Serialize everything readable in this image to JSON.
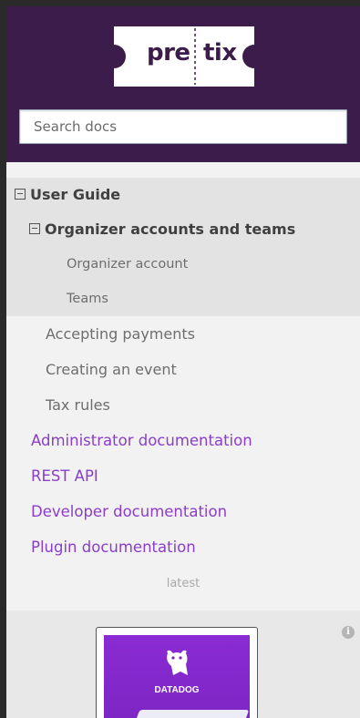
{
  "header": {
    "logo": {
      "left": "pre",
      "right": "tix"
    },
    "search": {
      "placeholder": "Search docs"
    }
  },
  "menu": {
    "user_guide": "User Guide",
    "organizer_accounts": "Organizer accounts and teams",
    "organizer_account": "Organizer account",
    "teams": "Teams",
    "accepting_payments": "Accepting payments",
    "creating_event": "Creating an event",
    "tax_rules": "Tax rules",
    "admin_docs": "Administrator documentation",
    "rest_api": "REST API",
    "developer_docs": "Developer documentation",
    "plugin_docs": "Plugin documentation"
  },
  "version": "latest",
  "ad": {
    "brand": "DATADOG",
    "info": "i"
  },
  "colors": {
    "header_bg": "#3b1c4a",
    "link": "#8a3ec9",
    "nav_bg": "#f2f2f2",
    "active_bg": "#e3e3e3"
  }
}
